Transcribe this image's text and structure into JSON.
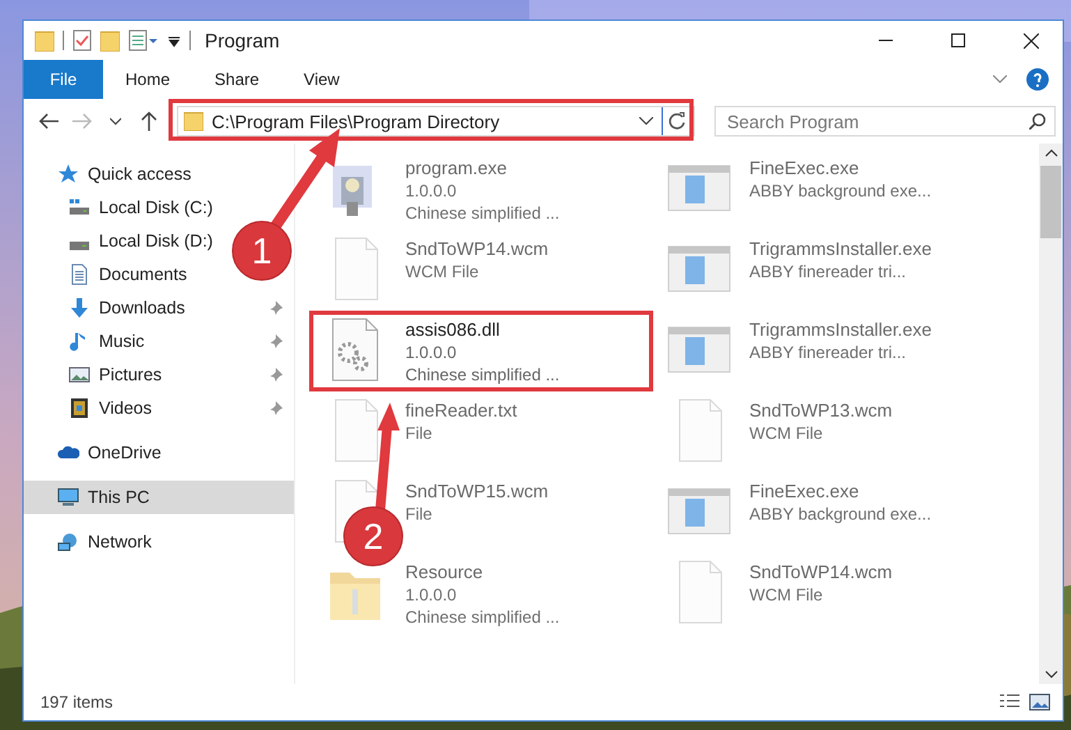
{
  "window": {
    "title": "Program"
  },
  "ribbon": {
    "tabs": [
      {
        "label": "File",
        "selected": true
      },
      {
        "label": "Home",
        "selected": false
      },
      {
        "label": "Share",
        "selected": false
      },
      {
        "label": "View",
        "selected": false
      }
    ]
  },
  "address_bar": {
    "path": "C:\\Program Files\\Program Directory",
    "highlighted": true
  },
  "search": {
    "placeholder": "Search Program"
  },
  "sidebar": {
    "items": [
      {
        "label": "Quick access",
        "kind": "star",
        "selected": false,
        "children": [
          {
            "label": "Local Disk (C:)",
            "kind": "drive-win",
            "pinned": false,
            "selected": false
          },
          {
            "label": "Local Disk (D:)",
            "kind": "drive",
            "pinned": false,
            "selected": false
          },
          {
            "label": "Documents",
            "kind": "docs",
            "pinned": false,
            "selected": false
          },
          {
            "label": "Downloads",
            "kind": "download",
            "pinned": true,
            "selected": false
          },
          {
            "label": "Music",
            "kind": "music",
            "pinned": true,
            "selected": false
          },
          {
            "label": "Pictures",
            "kind": "pictures",
            "pinned": true,
            "selected": false
          },
          {
            "label": "Videos",
            "kind": "videos",
            "pinned": true,
            "selected": false
          }
        ]
      },
      {
        "label": "OneDrive",
        "kind": "cloud",
        "selected": false
      },
      {
        "label": "This PC",
        "kind": "pc",
        "selected": true
      },
      {
        "label": "Network",
        "kind": "network",
        "selected": false
      }
    ]
  },
  "files": [
    {
      "name": "program.exe",
      "kind": "exe",
      "details": [
        "1.0.0.0",
        "Chinese simplified ..."
      ],
      "highlighted": false
    },
    {
      "name": "FineExec.exe",
      "kind": "app",
      "details": [
        "ABBY background exe..."
      ],
      "highlighted": false
    },
    {
      "name": "SndToWP14.wcm",
      "kind": "file",
      "details": [
        "WCM File"
      ],
      "highlighted": false
    },
    {
      "name": "TrigrammsInstaller.exe",
      "kind": "app",
      "details": [
        "ABBY finereader tri..."
      ],
      "highlighted": false
    },
    {
      "name": "assis086.dll",
      "kind": "dll",
      "details": [
        "1.0.0.0",
        "Chinese simplified ..."
      ],
      "highlighted": true
    },
    {
      "name": "TrigrammsInstaller.exe",
      "kind": "app",
      "details": [
        "ABBY finereader tri..."
      ],
      "highlighted": false
    },
    {
      "name": "fineReader.txt",
      "kind": "file",
      "details": [
        "File"
      ],
      "highlighted": false
    },
    {
      "name": "SndToWP13.wcm",
      "kind": "file",
      "details": [
        "WCM File"
      ],
      "highlighted": false
    },
    {
      "name": "SndToWP15.wcm",
      "kind": "file",
      "details": [
        "File"
      ],
      "highlighted": false
    },
    {
      "name": "FineExec.exe",
      "kind": "app",
      "details": [
        "ABBY background exe..."
      ],
      "highlighted": false
    },
    {
      "name": "Resource",
      "kind": "folder",
      "details": [
        "1.0.0.0",
        "Chinese simplified ..."
      ],
      "highlighted": false
    },
    {
      "name": "SndToWP14.wcm",
      "kind": "file",
      "details": [
        "WCM File"
      ],
      "highlighted": false
    }
  ],
  "status_bar": {
    "count": "197 items"
  },
  "callouts": [
    {
      "label": "1"
    },
    {
      "label": "2"
    }
  ]
}
